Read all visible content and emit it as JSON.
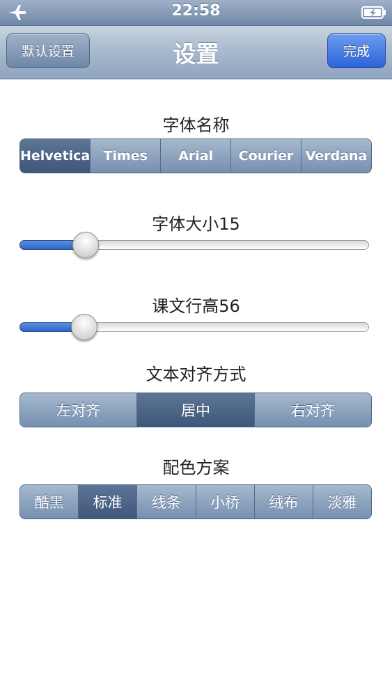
{
  "status_bar": {
    "time": "22:58",
    "left_icon": "airplane-mode-icon",
    "right_icon": "battery-charging-icon"
  },
  "nav": {
    "title": "设置",
    "left_button": "默认设置",
    "right_button": "完成"
  },
  "font_name": {
    "label": "字体名称",
    "options": [
      "Helvetica",
      "Times",
      "Arial",
      "Courier",
      "Verdana"
    ],
    "selected": "Helvetica"
  },
  "font_size": {
    "label": "字体大小15",
    "value": 15,
    "fraction": 0.19
  },
  "line_height": {
    "label": "课文行高56",
    "value": 56,
    "fraction": 0.185
  },
  "text_align": {
    "label": "文本对齐方式",
    "options": [
      "左对齐",
      "居中",
      "右对齐"
    ],
    "selected": "居中"
  },
  "color_scheme": {
    "label": "配色方案",
    "options": [
      "酷黑",
      "标准",
      "线条",
      "小桥",
      "绒布",
      "淡雅"
    ],
    "selected": "标准"
  },
  "colors": {
    "accent_blue": "#2b63d8",
    "bar_steel": "#7590b0",
    "selected_segment": "#3e5679"
  }
}
